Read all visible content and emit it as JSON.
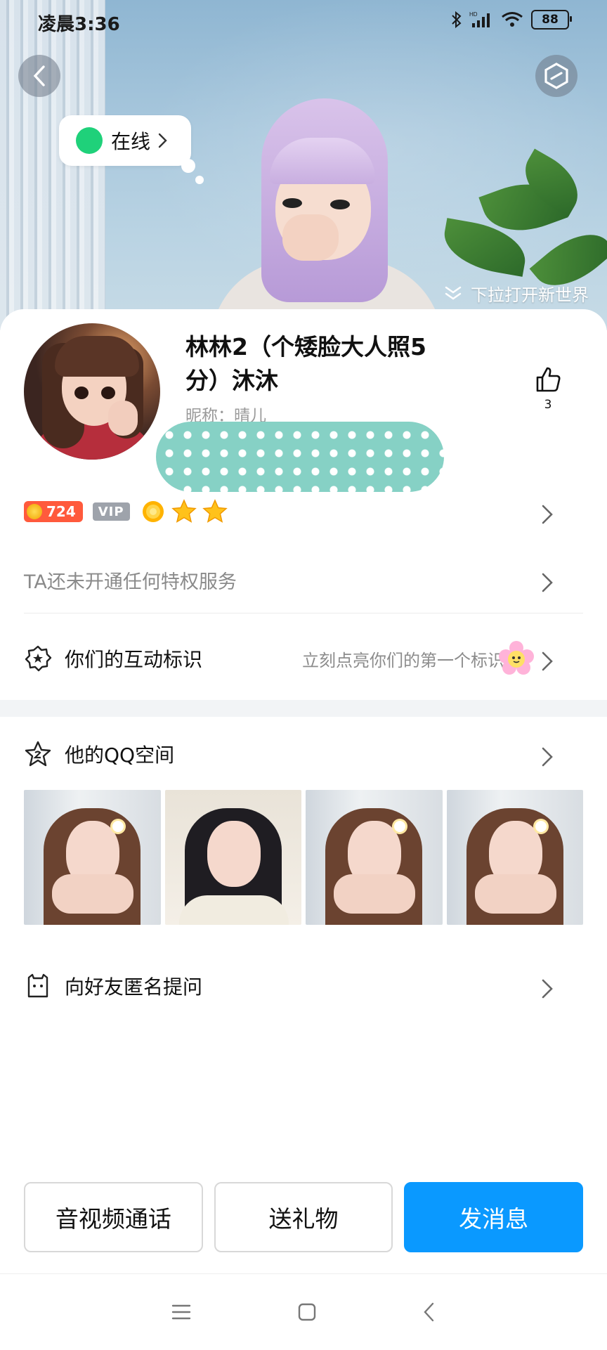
{
  "status_bar": {
    "time": "凌晨3:36",
    "battery": "88"
  },
  "hero": {
    "online_status": "在线",
    "pull_hint": "下拉打开新世界"
  },
  "profile": {
    "name_line1": "林林2（个矮脸大人照5",
    "name_line2": "分）沐沐",
    "nickname": "昵称：晴儿",
    "like_count": "3",
    "level": "724",
    "vip_label": "VIP"
  },
  "rows": {
    "privilege": "TA还未开通任何特权服务",
    "interaction_label": "你们的互动标识",
    "interaction_hint": "立刻点亮你们的第一个标识",
    "qzone_label": "他的QQ空间",
    "ask_label": "向好友匿名提问"
  },
  "actions": {
    "call": "音视频通话",
    "gift": "送礼物",
    "message": "发消息"
  },
  "colors": {
    "primary": "#0a99ff",
    "online": "#1fd17a",
    "level_badge": "#ff5a3c"
  }
}
